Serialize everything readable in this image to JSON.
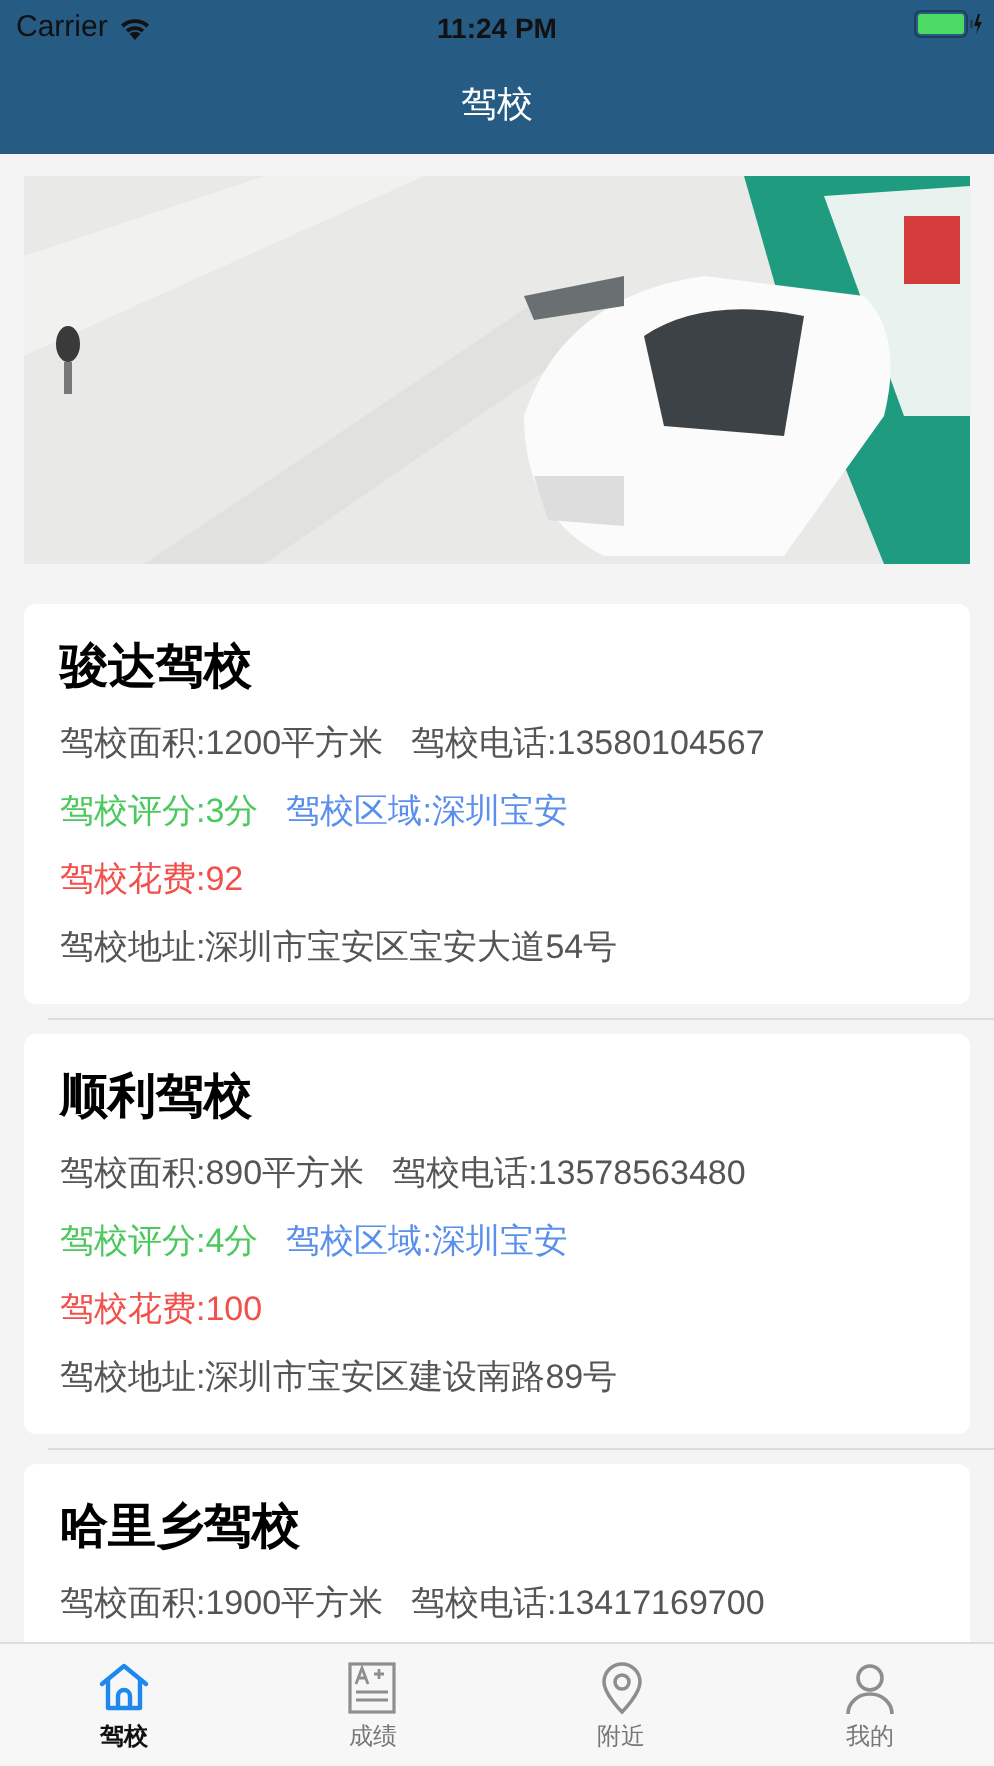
{
  "status_bar": {
    "carrier": "Carrier",
    "time": "11:24 PM"
  },
  "nav": {
    "title": "驾校"
  },
  "schools": [
    {
      "name": "骏达驾校",
      "area": "驾校面积:1200平方米",
      "phone": "驾校电话:13580104567",
      "rating": "驾校评分:3分",
      "region": "驾校区域:深圳宝安",
      "fee": "驾校花费:92",
      "address": "驾校地址:深圳市宝安区宝安大道54号"
    },
    {
      "name": "顺利驾校",
      "area": "驾校面积:890平方米",
      "phone": "驾校电话:13578563480",
      "rating": "驾校评分:4分",
      "region": "驾校区域:深圳宝安",
      "fee": "驾校花费:100",
      "address": "驾校地址:深圳市宝安区建设南路89号"
    },
    {
      "name": "哈里乡驾校",
      "area": "驾校面积:1900平方米",
      "phone": "驾校电话:13417169700"
    }
  ],
  "tabs": [
    {
      "kind": "home",
      "label": "驾校",
      "selected": true
    },
    {
      "kind": "grades",
      "label": "成绩",
      "selected": false
    },
    {
      "kind": "location",
      "label": "附近",
      "selected": false
    },
    {
      "kind": "profile",
      "label": "我的",
      "selected": false
    }
  ]
}
